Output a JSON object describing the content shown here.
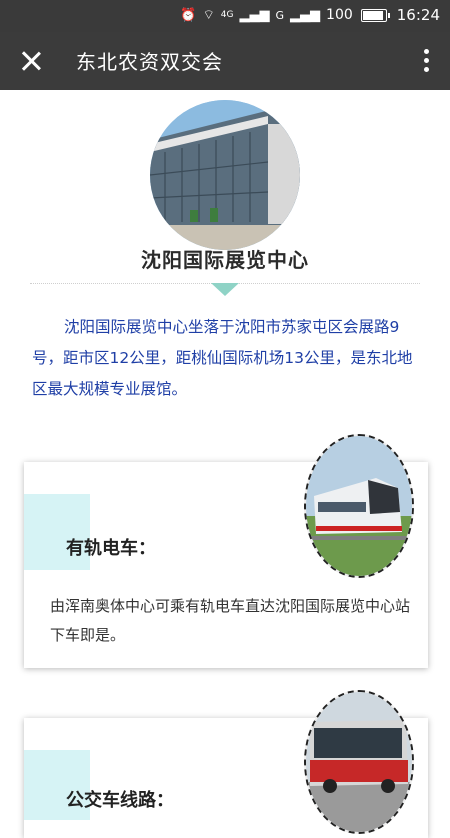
{
  "status_bar": {
    "network": "4G",
    "carrier": "G",
    "battery": "100",
    "time": "16:24"
  },
  "header": {
    "title": "东北农资双交会"
  },
  "venue": {
    "name": "沈阳国际展览中心",
    "intro": "沈阳国际展览中心坐落于沈阳市苏家屯区会展路9号，距市区12公里，距桃仙国际机场13公里，是东北地区最大规模专业展馆。"
  },
  "transport": [
    {
      "title": "有轨电车：",
      "description": "由浑南奥体中心可乘有轨电车直达沈阳国际展览中心站下车即是。"
    },
    {
      "title": "公交车线路："
    }
  ],
  "colors": {
    "header_bg": "#3b3b3b",
    "intro_text": "#1f3fa6",
    "accent": "#8fd3c6",
    "card_accent": "#d6f3f5"
  }
}
